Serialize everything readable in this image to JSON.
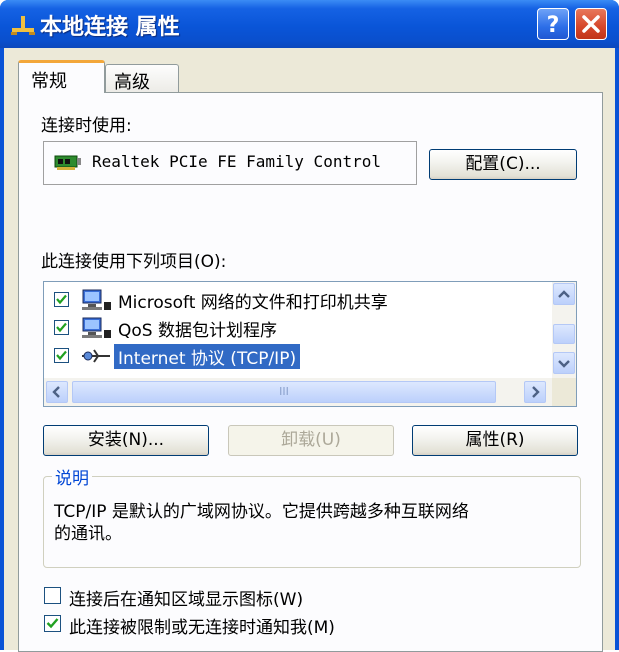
{
  "window": {
    "title": "本地连接 属性",
    "help_button": "?",
    "close_button": "×"
  },
  "tabs": [
    {
      "label": "常规",
      "active": true
    },
    {
      "label": "高级",
      "active": false
    }
  ],
  "connect_using": {
    "label": "连接时使用:",
    "adapter_name": "Realtek PCIe FE Family Control",
    "configure_button": "配置(C)..."
  },
  "components": {
    "label": "此连接使用下列项目(O):",
    "items": [
      {
        "label": "Microsoft 网络的文件和打印机共享",
        "checked": true,
        "icon": "network-computer-icon",
        "selected": false
      },
      {
        "label": "QoS 数据包计划程序",
        "checked": true,
        "icon": "network-computer-icon",
        "selected": false
      },
      {
        "label": "Internet 协议 (TCP/IP)",
        "checked": true,
        "icon": "protocol-icon",
        "selected": true
      }
    ],
    "scrollbar_grip": "III"
  },
  "buttons": {
    "install": "安装(N)...",
    "uninstall": "卸载(U)",
    "properties": "属性(R)"
  },
  "description": {
    "legend": "说明",
    "text_line1": "TCP/IP 是默认的广域网协议。它提供跨越多种互联网络",
    "text_line2": "的通讯。"
  },
  "options": [
    {
      "label": "连接后在通知区域显示图标(W)",
      "checked": false
    },
    {
      "label": "此连接被限制或无连接时通知我(M)",
      "checked": true
    }
  ],
  "colors": {
    "titlebar": "#0a55d8",
    "selection": "#316ac5",
    "tab_highlight": "#f3a73a",
    "groupbox_legend": "#0046d5"
  }
}
